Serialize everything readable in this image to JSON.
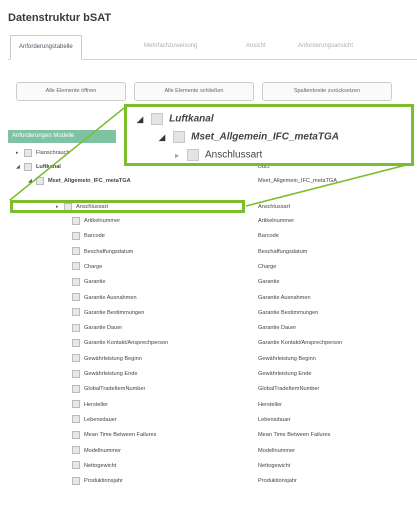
{
  "page": {
    "title": "Datenstruktur bSAT"
  },
  "tabs": [
    {
      "label": "Anforderungstabelle",
      "active": true
    },
    {
      "label": "Mehrfachzuweisung"
    },
    {
      "label": "Ansicht"
    },
    {
      "label": "Anforderungsansicht"
    }
  ],
  "toolbar": {
    "expand_all": "Alle Elemente öffnen",
    "collapse_all": "Alle Elemente schließen",
    "reset_columns": "Spaltenbreite zurücksetzen"
  },
  "tree": {
    "column_header": "Anforderungen Modelle",
    "nodes": [
      {
        "label": "Flanschrauch",
        "value": ""
      },
      {
        "label": "Luftkanal",
        "value": "Duct"
      },
      {
        "label": "Mset_Allgemein_IFC_metaTGA",
        "value": "Mset_Allgemein_IFC_metaTGA"
      },
      {
        "label": "Anschlussart",
        "value": "Anschlussart"
      },
      {
        "label": "Artikelnummer",
        "value": "Artikelnummer"
      },
      {
        "label": "Barcode",
        "value": "Barcode"
      },
      {
        "label": "Beschaffungsdatum",
        "value": "Beschaffungsdatum"
      },
      {
        "label": "Charge",
        "value": "Charge"
      },
      {
        "label": "Garantie",
        "value": "Garantie"
      },
      {
        "label": "Garantie Ausnahmen",
        "value": "Garantie Ausnahmen"
      },
      {
        "label": "Garantie Bestimmungen",
        "value": "Garantie Bestimmungen"
      },
      {
        "label": "Garantie Dauer",
        "value": "Garantie Dauer"
      },
      {
        "label": "Garantie Kontakt/Ansprechperson",
        "value": "Garantie Kontakt/Ansprechperson"
      },
      {
        "label": "Gewährleistung Beginn",
        "value": "Gewährleistung Beginn"
      },
      {
        "label": "Gewährleistung Ende",
        "value": "Gewährleistung Ende"
      },
      {
        "label": "GlobalTradeItemNumber",
        "value": "GlobalTradeItemNumber"
      },
      {
        "label": "Hersteller",
        "value": "Hersteller"
      },
      {
        "label": "Lebensdauer",
        "value": "Lebensdauer"
      },
      {
        "label": "Mean Time Between Failures",
        "value": "Mean Time Between Failures"
      },
      {
        "label": "Modellnummer",
        "value": "Modellnummer"
      },
      {
        "label": "Nettogewicht",
        "value": "Nettogewicht"
      },
      {
        "label": "Produktionsjahr",
        "value": "Produktionsjahr"
      }
    ]
  },
  "zoom": {
    "luftkanal": "Luftkanal",
    "mset": "Mset_Allgemein_IFC_metaTGA",
    "anschlussart": "Anschlussart"
  },
  "colors": {
    "highlight": "#7bbd2b",
    "header": "#7fc3a3"
  }
}
